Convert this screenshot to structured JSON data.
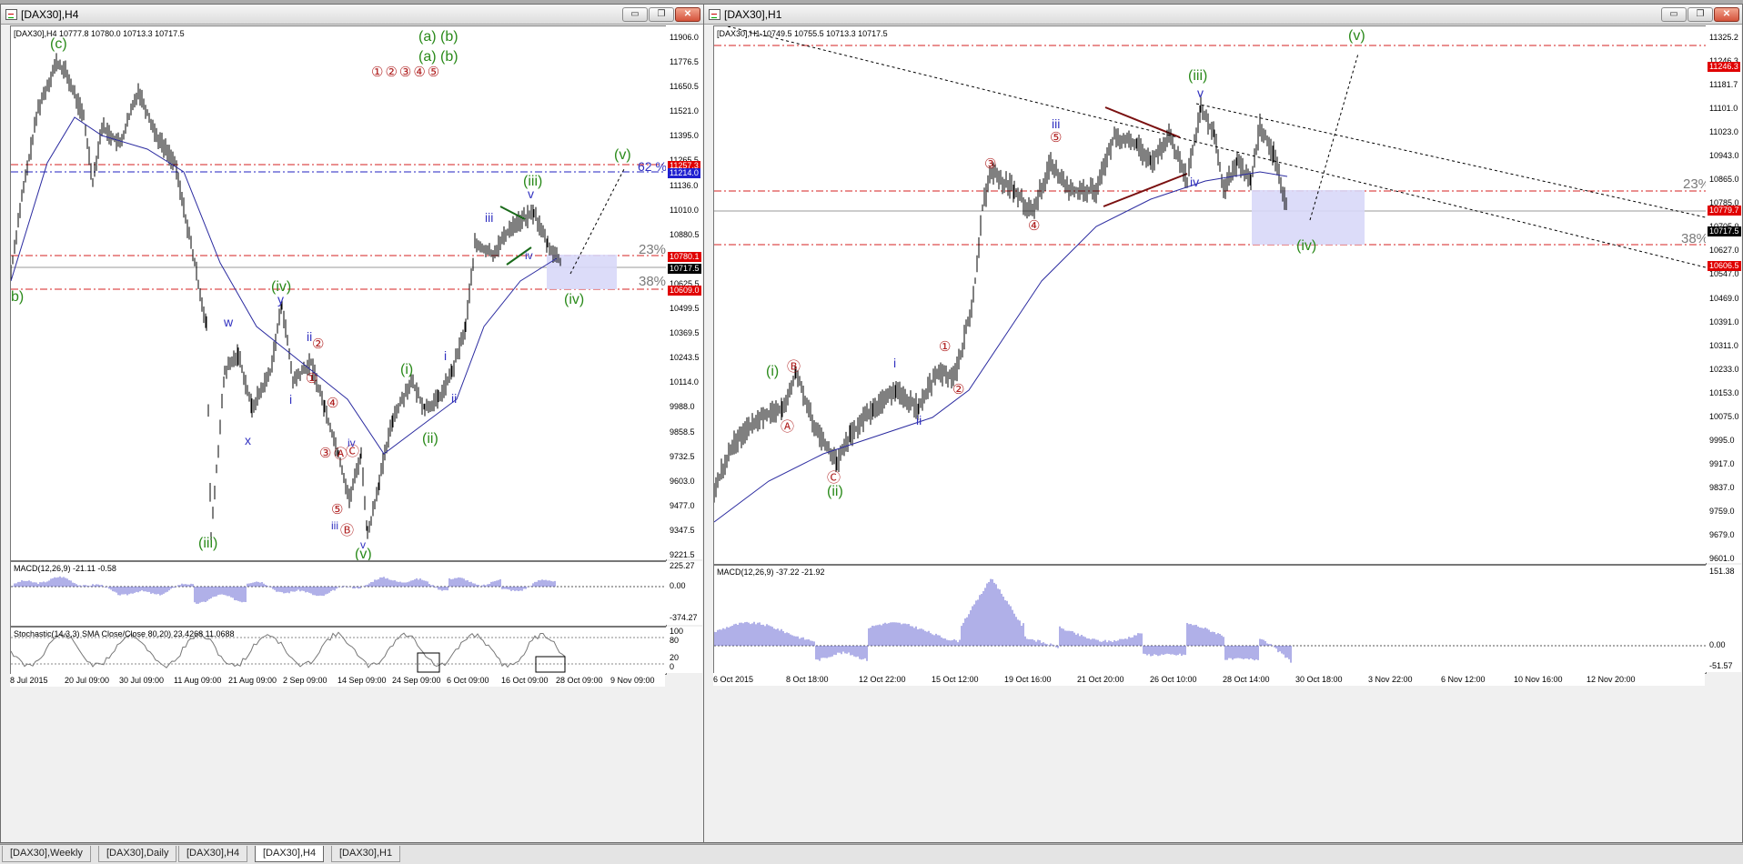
{
  "left_window": {
    "title": "[DAX30],H4",
    "controls": {
      "minimize": "▭",
      "restore": "❐",
      "close": "✕"
    },
    "info_line": "[DAX30],H4  10777.8 10780.0 10713.3 10717.5",
    "price_scale": [
      "11906.0",
      "11776.5",
      "11650.5",
      "11521.0",
      "11395.0",
      "11265.5",
      "11136.0",
      "11010.0",
      "10880.5",
      "10751.0",
      "10625.5",
      "10499.5",
      "10369.5",
      "10243.5",
      "10114.0",
      "9988.0",
      "9858.5",
      "9732.5",
      "9603.0",
      "9477.0",
      "9347.5",
      "9221.5"
    ],
    "price_tags": [
      {
        "text": "11257.3",
        "color": "#e00000"
      },
      {
        "text": "11214.0",
        "color": "#2020d0"
      },
      {
        "text": "10780.1",
        "color": "#e00000"
      },
      {
        "text": "10717.5",
        "color": "#000000"
      },
      {
        "text": "10609.0",
        "color": "#e00000"
      }
    ],
    "legend_marks": {
      "line1": "(a)  (b)",
      "line2": "(a)  (b)",
      "circles": "①②③④⑤"
    },
    "fib_labels": {
      "f62": "62 %",
      "f23": "23%",
      "f38": "38%"
    },
    "wave_labels": {
      "c_top": "(c)",
      "b_left": "b)",
      "iii_bottom": "(iii)",
      "iv_top": "(iv)",
      "y_top": "y",
      "w": "w",
      "x": "x",
      "ii_a": "ii",
      "circ2_a": "②",
      "circ1_a": "①",
      "i_a": "i",
      "circ4": "④",
      "circ3": "③",
      "circA": "Ⓐ",
      "circC": "Ⓒ",
      "iv_small": "iv",
      "circ5": "⑤",
      "circB": "Ⓑ",
      "iii_small": "iii",
      "v_small": "v",
      "v_bottom": "(v)",
      "i_paren": "(i)",
      "i_small": "i",
      "ii_small": "ii",
      "ii_paren": "(ii)",
      "iii_blue": "iii",
      "iii_paren": "(iii)",
      "v_blue": "v",
      "iv_blue": "iv",
      "v_target": "(v)",
      "iv_target": "(iv)"
    },
    "macd_label": "MACD(12,26,9) -21.11 -0.58",
    "macd_scale": [
      "225.27",
      "0.00",
      "-374.27"
    ],
    "stoch_label": "Stochastic(14,3,3) SMA Close/Close 80,20) 23.4268 11.0688",
    "stoch_scale": [
      "100",
      "80",
      "20",
      "0"
    ],
    "date_labels": [
      "8 Jul 2015",
      "20 Jul 09:00",
      "30 Jul 09:00",
      "11 Aug 09:00",
      "21 Aug 09:00",
      "2 Sep 09:00",
      "14 Sep 09:00",
      "24 Sep 09:00",
      "6 Oct 09:00",
      "16 Oct 09:00",
      "28 Oct 09:00",
      "9 Nov 09:00"
    ]
  },
  "right_window": {
    "title": "[DAX30],H1",
    "controls": {
      "minimize": "▭",
      "restore": "❐",
      "close": "✕"
    },
    "info_line": "[DAX30],H1  10749.5 10755.5 10713.3 10717.5",
    "price_scale": [
      "11325.2",
      "11246.3",
      "11181.7",
      "11101.0",
      "11023.0",
      "10943.0",
      "10865.0",
      "10785.0",
      "10705.0",
      "10627.0",
      "10547.0",
      "10469.0",
      "10391.0",
      "10311.0",
      "10233.0",
      "10153.0",
      "10075.0",
      "9995.0",
      "9917.0",
      "9837.0",
      "9759.0",
      "9679.0",
      "9601.0"
    ],
    "price_tags": [
      {
        "text": "11246.3",
        "color": "#e00000"
      },
      {
        "text": "10779.7",
        "color": "#e00000"
      },
      {
        "text": "10717.5",
        "color": "#000000"
      },
      {
        "text": "10606.5",
        "color": "#e00000"
      }
    ],
    "fib_labels": {
      "f23": "23%",
      "f38": "38%"
    },
    "wave_labels": {
      "v_top": "(v)",
      "iii_paren": "(iii)",
      "v_blue": "v",
      "iii_blue": "iii",
      "circ5": "⑤",
      "circ3": "③",
      "circ4": "④",
      "iv_blue": "iv",
      "iv_target": "(iv)",
      "circ1": "①",
      "circ2": "②",
      "i_blue": "i",
      "ii_blue": "ii",
      "i_paren": "(i)",
      "circB": "Ⓑ",
      "circA": "Ⓐ",
      "circC": "Ⓒ",
      "ii_paren": "(ii)"
    },
    "macd_label": "MACD(12,26,9) -37.22 -21.92",
    "macd_scale": [
      "151.38",
      "0.00",
      "-51.57"
    ],
    "date_labels": [
      "6 Oct 2015",
      "8 Oct 18:00",
      "12 Oct 22:00",
      "15 Oct 12:00",
      "19 Oct 16:00",
      "21 Oct 20:00",
      "26 Oct 10:00",
      "28 Oct 14:00",
      "30 Oct 18:00",
      "3 Nov 22:00",
      "6 Nov 12:00",
      "10 Nov 16:00",
      "12 Nov 20:00"
    ]
  },
  "tabs": [
    "[DAX30],Weekly",
    "[DAX30],Daily",
    "[DAX30],H4",
    "[DAX30],H4",
    "[DAX30],H1"
  ],
  "active_tab_index": 3,
  "colors": {
    "fib_line": "#d42020",
    "blue_line": "#2020c0",
    "ma_line": "#2b2ba0",
    "macd_bar": "#6060d0",
    "target_box": "#d8d8f8",
    "bg": "#ffffff"
  }
}
